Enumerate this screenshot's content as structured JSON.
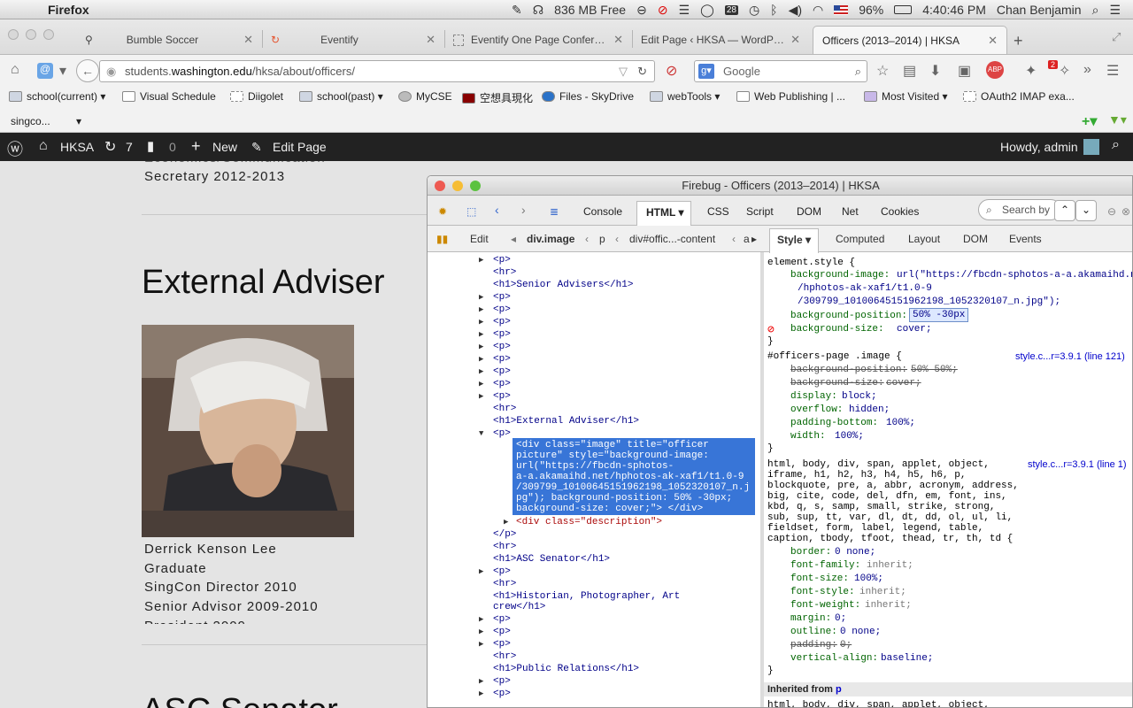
{
  "menubar": {
    "app_name": "Firefox",
    "memory": "836 MB Free",
    "calendar_badge": "28",
    "battery": "96%",
    "time": "4:40:46 PM",
    "user": "Chan Benjamin"
  },
  "tabs": [
    {
      "title": "Bumble Soccer"
    },
    {
      "title": "Eventify"
    },
    {
      "title": "Eventify One Page Confere..."
    },
    {
      "title": "Edit Page ‹ HKSA — WordPress"
    },
    {
      "title": "Officers (2013–2014) | HKSA"
    }
  ],
  "nav": {
    "url_prefix": "students.",
    "url_domain": "washington.edu",
    "url_path": "/hksa/about/officers/",
    "search_placeholder": "Google",
    "abp_badge": "2"
  },
  "bookmarks": [
    "school(current)",
    "Visual Schedule",
    "Diigolet",
    "school(past)",
    "MyCSE",
    "空想具現化",
    "Files - SkyDrive",
    "webTools",
    "Web Publishing | ...",
    "Most Visited",
    "OAuth2 IMAP exa..."
  ],
  "bookmarks_row2": "singco...",
  "wpbar": {
    "site": "HKSA",
    "updates": "7",
    "comments": "0",
    "new_label": "New",
    "edit_label": "Edit Page",
    "howdy": "Howdy, admin"
  },
  "page": {
    "top_line": "Secretary 2012-2013",
    "heading1": "External Adviser",
    "person_name": "Derrick Kenson Lee",
    "person_lines": [
      "Graduate",
      "SingCon Director 2010",
      "Senior Advisor 2009-2010"
    ],
    "heading2": "ASC Senator"
  },
  "firebug": {
    "title": "Firebug - Officers (2013–2014) | HKSA",
    "tabs": [
      "Console",
      "HTML",
      "CSS",
      "Script",
      "DOM",
      "Net",
      "Cookies"
    ],
    "search_placeholder": "Search by",
    "edit": "Edit",
    "breadcrumbs": [
      "div.image",
      "p",
      "div#offic...-content",
      "a"
    ],
    "side_tabs": [
      "Style",
      "Computed",
      "Layout",
      "DOM",
      "Events"
    ],
    "html_lines": [
      "<p>",
      "<hr>",
      "<h1>Senior Advisers</h1>",
      "<p>",
      "<p>",
      "<p>",
      "<p>",
      "<p>",
      "<p>",
      "<p>",
      "<p>",
      "<p>",
      "<hr>",
      "<h1>External Adviser</h1>",
      "<p>"
    ],
    "selected_block": "<div class=\"image\" title=\"officer\npicture\" style=\"background-image:\nurl(\"https://fbcdn-sphotos-\na-a.akamaihd.net/hphotos-ak-xaf1/t1.0-9\n/309799_10100645151962198_1052320107_n.j\npg\"); background-position: 50% -30px;\nbackground-size: cover;\"> </div>",
    "html_lines_after": [
      "<div class=\"description\">",
      "</p>",
      "<hr>",
      "<h1>ASC Senator</h1>",
      "<p>",
      "<hr>",
      "<h1>Historian, Photographer, Art",
      "crew</h1>",
      "<p>",
      "<p>",
      "<p>",
      "<hr>",
      "<h1>Public Relations</h1>",
      "<p>",
      "<p>"
    ],
    "style_rules": {
      "element_selector": "element.style {",
      "bg_image_1": "url(\"https://fbcdn-sphotos-a-a.akamaihd.net",
      "bg_image_2": "/hphotos-ak-xaf1/t1.0-9",
      "bg_image_3": "/309799_10100645151962198_1052320107_n.jpg\");",
      "bg_position_value": "50% -30px",
      "bg_size_value": "cover;",
      "rule2_selector": "#officers-page .image {",
      "rule2_source": "style.c...r=3.9.1 (line 121)",
      "rule2_props": [
        [
          "background-position:",
          "50% 50%;"
        ],
        [
          "background-size:",
          "cover;"
        ],
        [
          "display:",
          "block;"
        ],
        [
          "overflow:",
          "hidden;"
        ],
        [
          "padding-bottom:",
          "100%;"
        ],
        [
          "width:",
          "100%;"
        ]
      ],
      "rule3_selector_lines": [
        "html, body, div, span, applet, object,",
        "iframe, h1, h2, h3, h4, h5, h6, p,",
        "blockquote, pre, a, abbr, acronym, address,",
        "big, cite, code, del, dfn, em, font, ins,",
        "kbd, q, s, samp, small, strike, strong,",
        "sub, sup, tt, var, dl, dt, dd, ol, ul, li,",
        "fieldset, form, label, legend, table,",
        "caption, tbody, tfoot, thead, tr, th, td {"
      ],
      "rule3_source": "style.c...r=3.9.1 (line 1)",
      "rule3_props": [
        [
          "border:",
          "0 none;"
        ],
        [
          "font-family:",
          "inherit;"
        ],
        [
          "font-size:",
          "100%;"
        ],
        [
          "font-style:",
          "inherit;"
        ],
        [
          "font-weight:",
          "inherit;"
        ],
        [
          "margin:",
          "0;"
        ],
        [
          "outline:",
          "0 none;"
        ],
        [
          "padding:",
          "0;"
        ],
        [
          "vertical-align:",
          "baseline;"
        ]
      ],
      "inherited_label": "Inherited from",
      "inherited_from": "p",
      "last_line": "html, body, div, span, applet, object,"
    }
  }
}
